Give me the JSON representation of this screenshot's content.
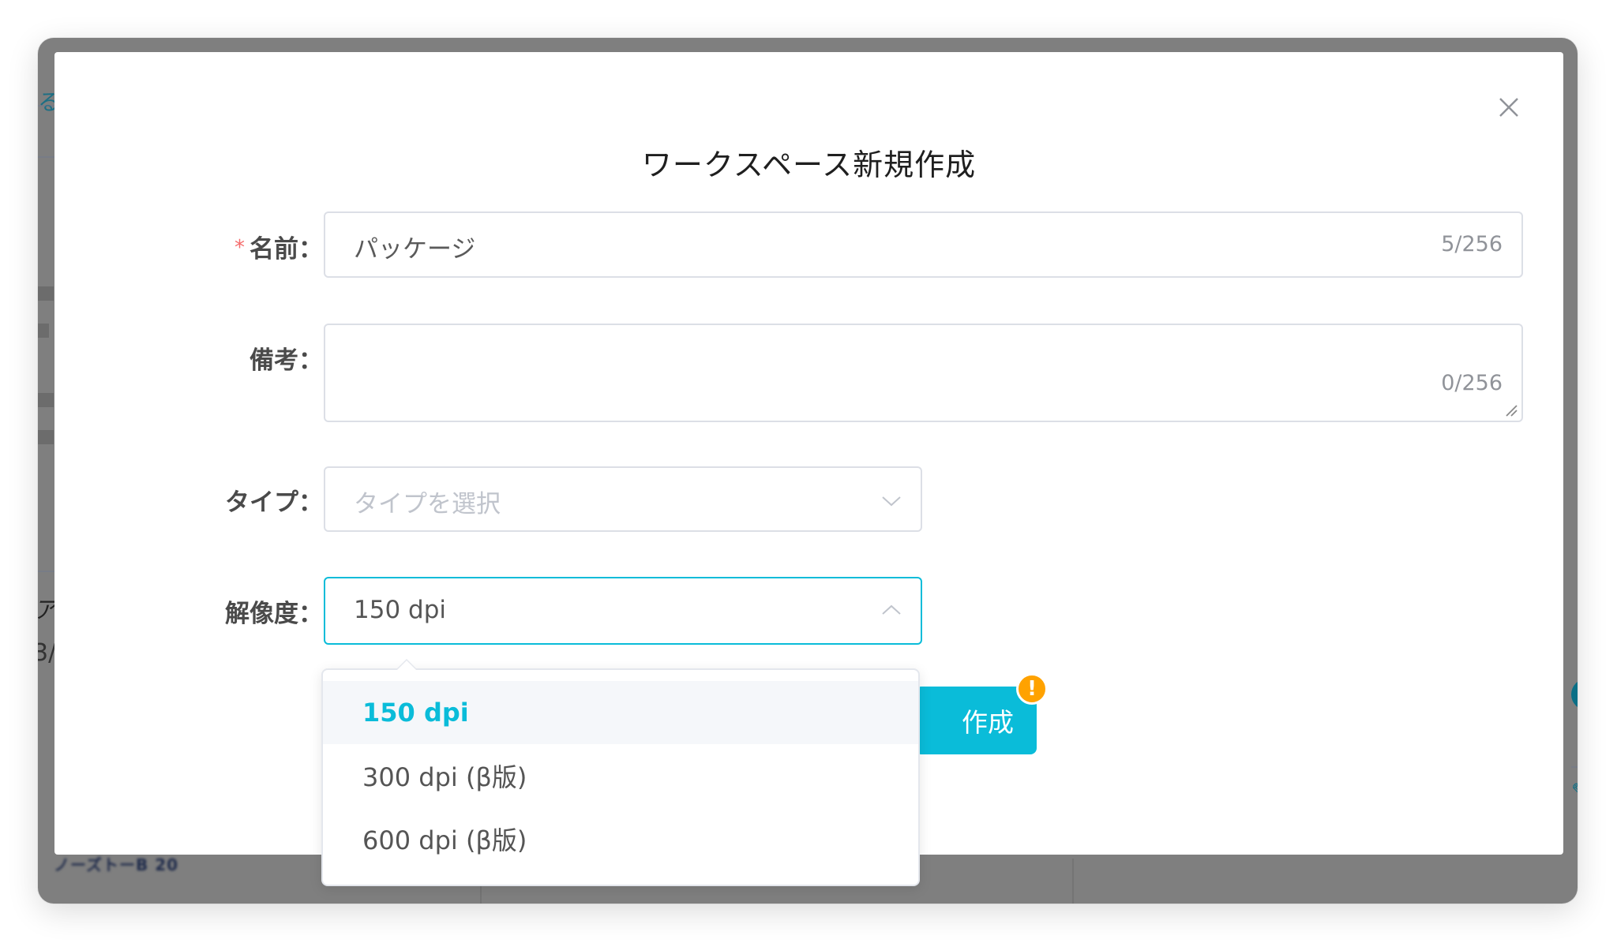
{
  "dialog": {
    "title": "ワークスペース新規作成",
    "close_icon": "close-icon"
  },
  "form": {
    "name": {
      "required_mark": "*",
      "label": "名前：",
      "value": "パッケージ",
      "counter": "5/256"
    },
    "note": {
      "label": "備考：",
      "value": "",
      "counter": "0/256"
    },
    "type": {
      "label": "タイプ：",
      "placeholder": "タイプを選択",
      "icon": "chevron-down-icon"
    },
    "resolution": {
      "label": "解像度：",
      "value": "150 dpi",
      "icon": "chevron-up-icon",
      "options": [
        {
          "label": "150 dpi",
          "selected": true
        },
        {
          "label": "300 dpi (β版)",
          "selected": false
        },
        {
          "label": "600 dpi (β版)",
          "selected": false
        }
      ]
    }
  },
  "actions": {
    "create_label": "作成",
    "warning_badge": "!"
  },
  "colors": {
    "accent": "#0abcd9",
    "warning": "#ffa200",
    "required": "#f56c6c"
  }
}
